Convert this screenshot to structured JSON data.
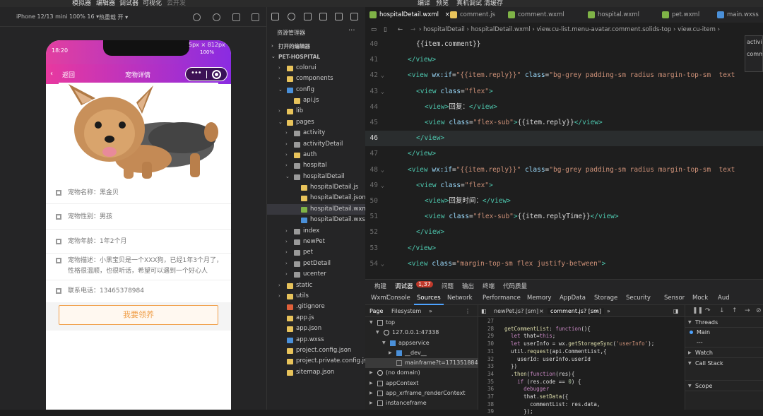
{
  "menu": [
    "模拟器",
    "编辑器",
    "调试器",
    "可视化",
    "云开发",
    "编译",
    "预览",
    "真机调试",
    "清缓存"
  ],
  "simulator": {
    "device": "iPhone 12/13 mini 100% 16 ▾",
    "hotreload": "热重载 开 ▾",
    "px_label": "5px × 812px",
    "status_time": "18:20",
    "battery": "100%",
    "nav": {
      "back": "返回",
      "title": "宠物详情"
    },
    "rows": [
      {
        "text": "宠物名称：黑金贝"
      },
      {
        "text": "宠物性别：男孩"
      },
      {
        "text": "宠物年龄：1年2个月"
      },
      {
        "text": "宠物描述：小黑宝贝是一个XXX狗，已经1年3个月了，性格很温顺，也很听话，希望可以遇到一个好心人"
      },
      {
        "text": "联系电话：13465378984"
      }
    ],
    "adopt_button": "我要领养"
  },
  "explorer": {
    "title": "资源管理器",
    "more": "···",
    "items": [
      {
        "label": "打开的编辑器",
        "indent": 0,
        "kind": "head",
        "arrow": "›"
      },
      {
        "label": "PET-HOSPITAL",
        "indent": 0,
        "kind": "head",
        "arrow": "⌄"
      },
      {
        "label": "colorui",
        "indent": 1,
        "kind": "folder",
        "arrow": "›"
      },
      {
        "label": "components",
        "indent": 1,
        "kind": "folder",
        "arrow": "›"
      },
      {
        "label": "config",
        "indent": 1,
        "kind": "folder-blue",
        "arrow": "⌄"
      },
      {
        "label": "api.js",
        "indent": 2,
        "kind": "js",
        "arrow": ""
      },
      {
        "label": "lib",
        "indent": 1,
        "kind": "folder",
        "arrow": "›"
      },
      {
        "label": "pages",
        "indent": 1,
        "kind": "folder",
        "arrow": "⌄"
      },
      {
        "label": "activity",
        "indent": 2,
        "kind": "folder-grey",
        "arrow": "›"
      },
      {
        "label": "activityDetail",
        "indent": 2,
        "kind": "folder-grey",
        "arrow": "›"
      },
      {
        "label": "auth",
        "indent": 2,
        "kind": "folder",
        "arrow": "›"
      },
      {
        "label": "hospital",
        "indent": 2,
        "kind": "folder-grey",
        "arrow": "›"
      },
      {
        "label": "hospitalDetail",
        "indent": 2,
        "kind": "folder-grey",
        "arrow": "⌄"
      },
      {
        "label": "hospitalDetail.js",
        "indent": 3,
        "kind": "js",
        "arrow": ""
      },
      {
        "label": "hospitalDetail.json",
        "indent": 3,
        "kind": "json",
        "arrow": ""
      },
      {
        "label": "hospitalDetail.wxml",
        "indent": 3,
        "kind": "wxml",
        "arrow": "",
        "selected": true
      },
      {
        "label": "hospitalDetail.wxss",
        "indent": 3,
        "kind": "wxss",
        "arrow": ""
      },
      {
        "label": "index",
        "indent": 2,
        "kind": "folder-grey",
        "arrow": "›"
      },
      {
        "label": "newPet",
        "indent": 2,
        "kind": "folder-grey",
        "arrow": "›"
      },
      {
        "label": "pet",
        "indent": 2,
        "kind": "folder-grey",
        "arrow": "›"
      },
      {
        "label": "petDetail",
        "indent": 2,
        "kind": "folder-grey",
        "arrow": "›"
      },
      {
        "label": "ucenter",
        "indent": 2,
        "kind": "folder-grey",
        "arrow": "›"
      },
      {
        "label": "static",
        "indent": 1,
        "kind": "folder",
        "arrow": "›"
      },
      {
        "label": "utils",
        "indent": 1,
        "kind": "folder",
        "arrow": "›"
      },
      {
        "label": ".gitignore",
        "indent": 1,
        "kind": "git",
        "arrow": ""
      },
      {
        "label": "app.js",
        "indent": 1,
        "kind": "js",
        "arrow": ""
      },
      {
        "label": "app.json",
        "indent": 1,
        "kind": "json",
        "arrow": ""
      },
      {
        "label": "app.wxss",
        "indent": 1,
        "kind": "wxss",
        "arrow": ""
      },
      {
        "label": "project.config.json",
        "indent": 1,
        "kind": "json",
        "arrow": ""
      },
      {
        "label": "project.private.config.js...",
        "indent": 1,
        "kind": "json",
        "arrow": ""
      },
      {
        "label": "sitemap.json",
        "indent": 1,
        "kind": "json",
        "arrow": ""
      }
    ]
  },
  "editor": {
    "tabs": [
      "hospitalDetail.wxml",
      "comment.js",
      "comment.wxml",
      "hospital.wxml",
      "pet.wxml",
      "main.wxss"
    ],
    "breadcrumb": "› hospitalDetail  ›  hospitalDetail.wxml  ›  view.cu-list.menu-avatar.comment.solids-top  ›  view.cu-item  ›",
    "suggest": [
      "activi",
      "comm"
    ],
    "lines": [
      {
        "no": "40",
        "indent": 3,
        "html": "<span class='p'>{{item.comment}}</span>"
      },
      {
        "no": "41",
        "indent": 2,
        "html": "<span class='t'>&lt;/view&gt;</span>"
      },
      {
        "no": "42",
        "indent": 2,
        "fold": true,
        "html": "<span class='t'>&lt;view</span> <span class='a'>wx:if</span><span class='p'>=</span><span class='s'>\"{{item.reply}}\"</span> <span class='a'>class</span><span class='p'>=</span><span class='s'>\"bg-grey padding-sm radius margin-top-sm  text</span>"
      },
      {
        "no": "43",
        "indent": 3,
        "fold": true,
        "html": "<span class='t'>&lt;view</span> <span class='a'>class</span><span class='p'>=</span><span class='s'>\"flex\"</span><span class='t'>&gt;</span>"
      },
      {
        "no": "44",
        "indent": 4,
        "html": "<span class='t'>&lt;view&gt;</span><span class='p'>回复：</span><span class='t'>&lt;/view&gt;</span>"
      },
      {
        "no": "45",
        "indent": 4,
        "html": "<span class='t'>&lt;view</span> <span class='a'>class</span><span class='p'>=</span><span class='s'>\"flex-sub\"</span><span class='t'>&gt;</span><span class='p'>{{item.reply}}</span><span class='t'>&lt;/view&gt;</span>"
      },
      {
        "no": "46",
        "indent": 3,
        "cur": true,
        "html": "<span class='t'>&lt;/view&gt;</span>"
      },
      {
        "no": "47",
        "indent": 2,
        "html": "<span class='t'>&lt;/view&gt;</span>"
      },
      {
        "no": "48",
        "indent": 2,
        "fold": true,
        "html": "<span class='t'>&lt;view</span> <span class='a'>wx:if</span><span class='p'>=</span><span class='s'>\"{{item.reply}}\"</span> <span class='a'>class</span><span class='p'>=</span><span class='s'>\"bg-grey padding-sm radius margin-top-sm  text</span>"
      },
      {
        "no": "49",
        "indent": 3,
        "fold": true,
        "html": "<span class='t'>&lt;view</span> <span class='a'>class</span><span class='p'>=</span><span class='s'>\"flex\"</span><span class='t'>&gt;</span>"
      },
      {
        "no": "50",
        "indent": 4,
        "html": "<span class='t'>&lt;view&gt;</span><span class='p'>回复时间：</span><span class='t'>&lt;/view&gt;</span>"
      },
      {
        "no": "51",
        "indent": 4,
        "html": "<span class='t'>&lt;view</span> <span class='a'>class</span><span class='p'>=</span><span class='s'>\"flex-sub\"</span><span class='t'>&gt;</span><span class='p'>{{item.replyTime}}</span><span class='t'>&lt;/view&gt;</span>"
      },
      {
        "no": "52",
        "indent": 3,
        "html": "<span class='t'>&lt;/view&gt;</span>"
      },
      {
        "no": "53",
        "indent": 2,
        "html": "<span class='t'>&lt;/view&gt;</span>"
      },
      {
        "no": "54",
        "indent": 2,
        "fold": true,
        "html": "<span class='t'>&lt;view</span> <span class='a'>class</span><span class='p'>=</span><span class='s'>\"margin-top-sm flex justify-between\"</span><span class='t'>&gt;</span>"
      }
    ]
  },
  "devtools": {
    "panel_tabs": [
      "构建",
      "调试器",
      "1,37",
      "问题",
      "输出",
      "终端",
      "代码质量"
    ],
    "sub_tabs": [
      "Wxml",
      "Console",
      "Sources",
      "Network",
      "Performance",
      "Memory",
      "AppData",
      "Storage",
      "Security",
      "Sensor",
      "Mock",
      "Aud"
    ],
    "left_tabs": [
      "Page",
      "Filesystem"
    ],
    "tree": [
      {
        "label": "top",
        "indent": 0,
        "arrow": "▼",
        "icon": "box"
      },
      {
        "label": "127.0.0.1:47338",
        "indent": 1,
        "arrow": "▼",
        "icon": "cloud"
      },
      {
        "label": "appservice",
        "indent": 2,
        "arrow": "▼",
        "icon": "folder"
      },
      {
        "label": "__dev__",
        "indent": 3,
        "arrow": "▶",
        "icon": "folder"
      },
      {
        "label": "mainframe?t=171351884635",
        "indent": 3,
        "arrow": "",
        "icon": "file",
        "selected": true
      },
      {
        "label": "(no domain)",
        "indent": 0,
        "arrow": "▶",
        "icon": "cloud"
      },
      {
        "label": "appContext",
        "indent": 0,
        "arrow": "▶",
        "icon": "box"
      },
      {
        "label": "app_xrframe_renderContext",
        "indent": 0,
        "arrow": "▶",
        "icon": "box"
      },
      {
        "label": "instanceframe",
        "indent": 0,
        "arrow": "▶",
        "icon": "box"
      }
    ],
    "code_tabs": [
      "newPet.js? [sm]",
      "comment.js? [sm]"
    ],
    "code": [
      {
        "no": "27",
        "html": ""
      },
      {
        "no": "28",
        "html": "<span class='fn'>getCommentList</span>: <span class='kw'>function</span>(){"
      },
      {
        "no": "29",
        "html": "  <span class='kw'>let</span> that=<span class='kw'>this</span>;"
      },
      {
        "no": "30",
        "html": "  <span class='kw'>let</span> userInfo = wx.<span class='fn'>getStorageSync</span>(<span class='str'>'userInfo'</span>);"
      },
      {
        "no": "31",
        "html": "  util.<span class='fn'>request</span>(api.CommentList,{"
      },
      {
        "no": "32",
        "html": "    userId: userInfo.userId"
      },
      {
        "no": "33",
        "html": "  })"
      },
      {
        "no": "34",
        "html": "  .<span class='fn'>then</span>(<span class='kw'>function</span>(res){"
      },
      {
        "no": "35",
        "html": "    <span class='kw'>if</span> (res.code == <span class='nm'>0</span>) {"
      },
      {
        "no": "36",
        "html": "      <span class='dbg'>debugger</span>"
      },
      {
        "no": "37",
        "html": "      that.<span class='fn'>setData</span>({"
      },
      {
        "no": "38",
        "html": "        commentList: res.data,"
      },
      {
        "no": "39",
        "html": "      });"
      }
    ],
    "debug": {
      "threads": "Threads",
      "main": "Main",
      "dashes": "---",
      "watch": "Watch",
      "callstack": "Call Stack",
      "scope": "Scope"
    }
  }
}
